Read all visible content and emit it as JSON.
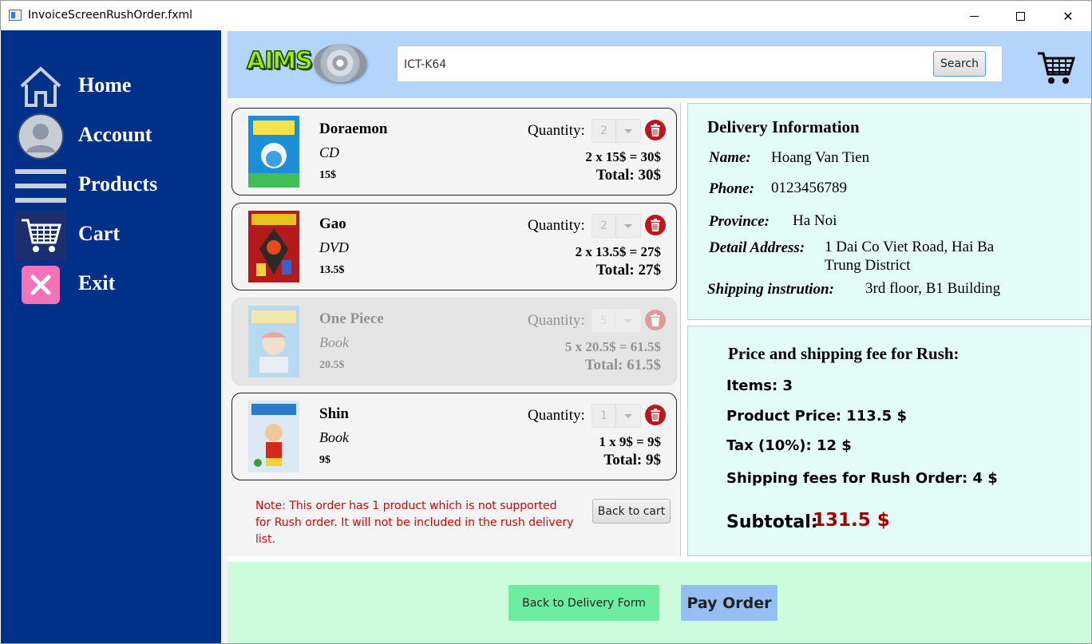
{
  "window": {
    "title": "InvoiceScreenRushOrder.fxml",
    "controls": [
      "minimize-icon",
      "maximize-icon",
      "close-icon"
    ]
  },
  "sidebar": {
    "items": [
      {
        "label": "Home",
        "icon": "home-icon"
      },
      {
        "label": "Account",
        "icon": "account-icon"
      },
      {
        "label": "Products",
        "icon": "menu-icon"
      },
      {
        "label": "Cart",
        "icon": "cart-icon",
        "active": true
      },
      {
        "label": "Exit",
        "icon": "exit-icon"
      }
    ]
  },
  "header": {
    "logo_text": "AIMS",
    "search_value": "ICT-K64",
    "search_button": "Search",
    "cart_icon": "cart-icon"
  },
  "cart": {
    "items": [
      {
        "name": "Doraemon",
        "kind": "CD",
        "price": "15$",
        "quantity_label": "Quantity:",
        "quantity": "2",
        "formula": "2 x 15$ = 30$",
        "total": "Total: 30$",
        "supported": true
      },
      {
        "name": "Gao",
        "kind": "DVD",
        "price": "13.5$",
        "quantity_label": "Quantity:",
        "quantity": "2",
        "formula": "2 x 13.5$ = 27$",
        "total": "Total: 27$",
        "supported": true
      },
      {
        "name": "One Piece",
        "kind": "Book",
        "price": "20.5$",
        "quantity_label": "Quantity:",
        "quantity": "5",
        "formula": "5 x 20.5$ = 61.5$",
        "total": "Total: 61.5$",
        "supported": false
      },
      {
        "name": "Shin",
        "kind": "Book",
        "price": "9$",
        "quantity_label": "Quantity:",
        "quantity": "1",
        "formula": "1 x 9$ = 9$",
        "total": "Total: 9$",
        "supported": true
      }
    ],
    "note": "Note: This order has 1 product which is not supported for Rush order. It will not be included in the rush delivery list.",
    "back_to_cart": "Back to cart"
  },
  "delivery": {
    "title": "Delivery Information",
    "name_label": "Name:",
    "name": "Hoang Van Tien",
    "phone_label": "Phone:",
    "phone": "0123456789",
    "province_label": "Province:",
    "province": "Ha Noi",
    "address_label": "Detail Address:",
    "address_line1": "1 Dai Co Viet Road, Hai Ba",
    "address_line2": "Trung District",
    "instruction_label": "Shipping instrution:",
    "instruction": "3rd floor, B1 Building"
  },
  "pricing": {
    "title": "Price and shipping fee for Rush:",
    "items": "Items: 3",
    "product_price": "Product Price: 113.5 $",
    "tax": "Tax (10%): 12 $",
    "shipping": "Shipping fees for Rush Order: 4 $",
    "subtotal_label": "Subtotal:",
    "subtotal_value": "131.5 $"
  },
  "footer": {
    "back_button": "Back to Delivery Form",
    "pay_button": "Pay Order"
  },
  "colors": {
    "sidebar": "#003087",
    "header": "#b3d4fb",
    "panel": "#e3fcf7",
    "footer": "#ccfcdc",
    "note": "#e10000",
    "subtotal": "#a10000",
    "back_button": "#6eeda1",
    "pay_button": "#95bff2"
  }
}
